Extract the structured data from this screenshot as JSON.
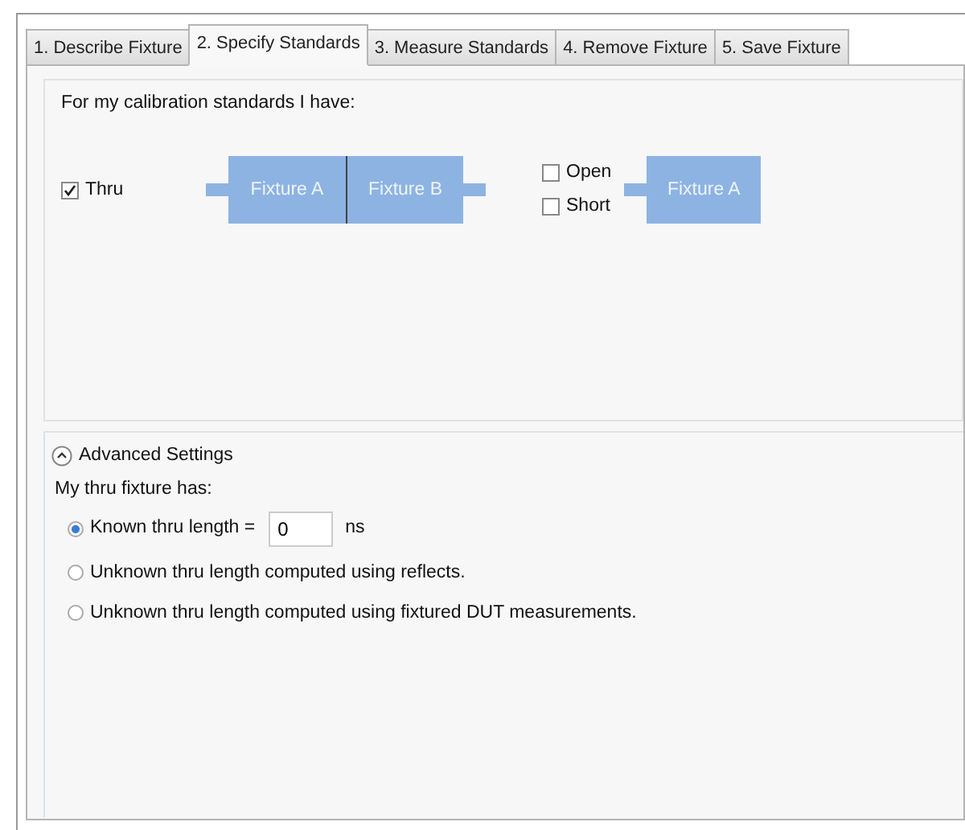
{
  "tabs": [
    {
      "label": "1. Describe Fixture",
      "selected": false
    },
    {
      "label": "2. Specify Standards",
      "selected": true
    },
    {
      "label": "3. Measure Standards",
      "selected": false
    },
    {
      "label": "4. Remove Fixture",
      "selected": false
    },
    {
      "label": "5. Save Fixture",
      "selected": false
    }
  ],
  "standards": {
    "title": "For my calibration standards I have:",
    "thru": {
      "label": "Thru",
      "checked": true,
      "fixtures": [
        "Fixture A",
        "Fixture B"
      ]
    },
    "reflects": [
      {
        "label": "Open",
        "checked": false
      },
      {
        "label": "Short",
        "checked": false
      }
    ],
    "reflect_fixture": "Fixture A"
  },
  "advanced": {
    "title": "Advanced Settings",
    "expanded": true,
    "intro": "My thru fixture has:",
    "options": [
      {
        "kind": "input",
        "label": "Known thru length =",
        "value": "0",
        "unit": "ns",
        "selected": true
      },
      {
        "kind": "plain",
        "label": "Unknown thru length computed using reflects.",
        "selected": false
      },
      {
        "kind": "plain",
        "label": "Unknown thru length computed using fixtured DUT measurements.",
        "selected": false
      }
    ]
  }
}
